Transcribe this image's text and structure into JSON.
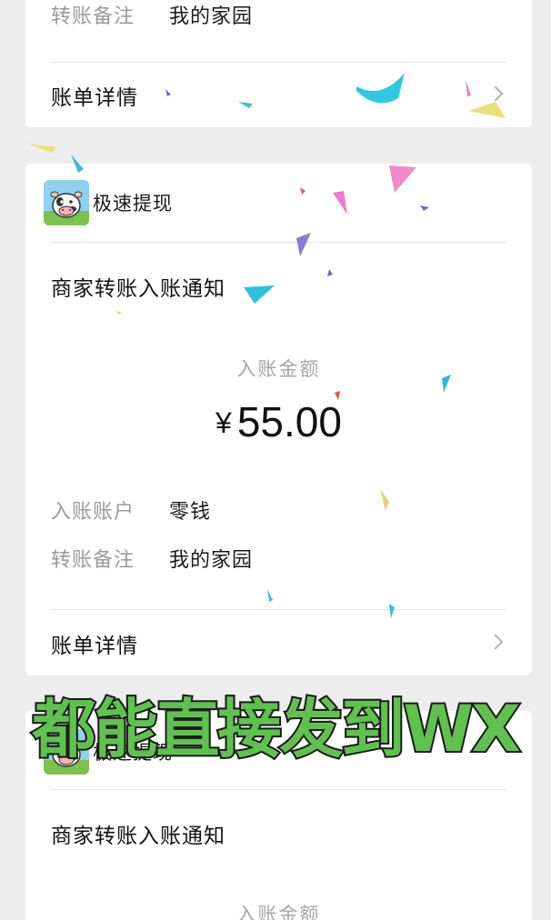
{
  "top_card": {
    "remark_label": "转账备注",
    "remark_value": "我的家园",
    "detail_label": "账单详情"
  },
  "middle_card": {
    "merchant_name": "极速提现",
    "notice_title": "商家转账入账通知",
    "amount_label": "入账金额",
    "currency_symbol": "¥",
    "amount_value": "55.00",
    "account_label": "入账账户",
    "account_value": "零钱",
    "remark_label": "转账备注",
    "remark_value": "我的家园",
    "detail_label": "账单详情"
  },
  "bottom_card": {
    "merchant_name": "极速提现",
    "notice_title": "商家转账入账通知",
    "amount_label": "入账金额"
  },
  "overlay": {
    "caption": "都能直接发到WX"
  },
  "colors": {
    "background": "#ededed",
    "card": "#ffffff",
    "caption_fill": "#5fc24e",
    "caption_stroke": "#1a1a1a"
  },
  "icons": {
    "avatar": "cow-avatar-icon",
    "chevron": "chevron-right-icon"
  }
}
